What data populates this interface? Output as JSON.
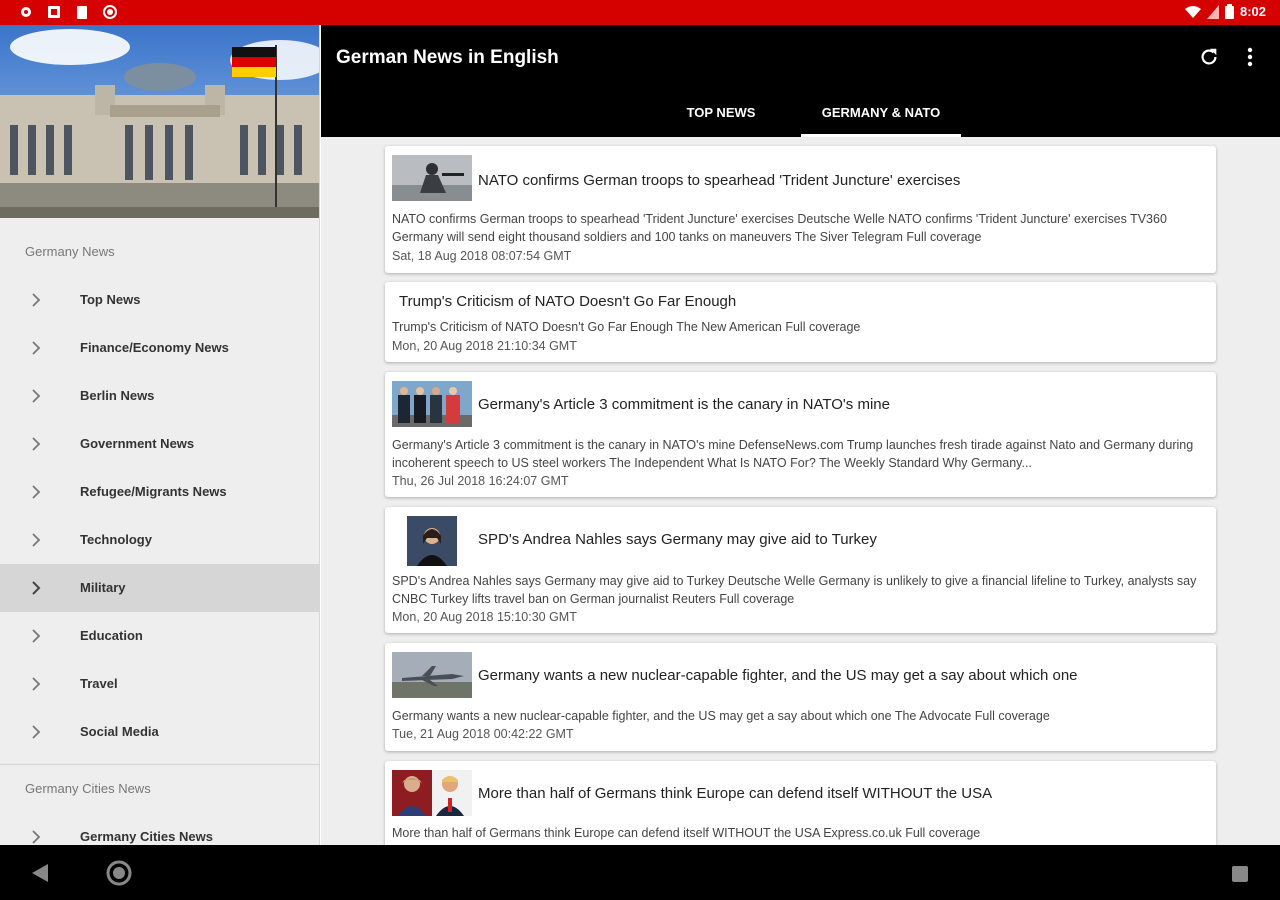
{
  "status_bar": {
    "time": "8:02",
    "left_icons": [
      "settings-icon",
      "screenshot-icon",
      "clipboard-icon",
      "record-icon"
    ],
    "right_icons": [
      "wifi-icon",
      "signal-icon",
      "battery-icon"
    ]
  },
  "app": {
    "title": "German News in English",
    "actions": [
      "refresh-icon",
      "more-vert-icon"
    ],
    "tabs": [
      {
        "label": "TOP NEWS",
        "selected": false
      },
      {
        "label": "GERMANY & NATO",
        "selected": true
      }
    ]
  },
  "drawer": {
    "hero_image": "reichstag-building-image",
    "section1": "Germany News",
    "items": [
      {
        "label": "Top News"
      },
      {
        "label": "Finance/Economy News"
      },
      {
        "label": "Berlin News"
      },
      {
        "label": "Government News"
      },
      {
        "label": "Refugee/Migrants News"
      },
      {
        "label": "Technology"
      },
      {
        "label": "Military",
        "selected": true
      },
      {
        "label": "Education"
      },
      {
        "label": "Travel"
      },
      {
        "label": "Social Media"
      }
    ],
    "section2": "Germany Cities News",
    "items2": [
      {
        "label": "Germany Cities News"
      }
    ]
  },
  "articles": [
    {
      "headline": "NATO confirms German troops to spearhead 'Trident Juncture' exercises",
      "snippet": "NATO confirms German troops to spearhead 'Trident Juncture' exercises  Deutsche Welle  NATO confirms 'Trident Juncture' exercises  TV360  Germany will send eight thousand soldiers and 100 tanks on maneuvers  The Siver Telegram  Full coverage",
      "date": "Sat, 18 Aug 2018 08:07:54 GMT",
      "thumb": "soldier-thumbnail"
    },
    {
      "headline": "Trump's Criticism of NATO Doesn't Go Far Enough",
      "snippet": "Trump's Criticism of NATO Doesn't Go Far Enough  The New American  Full coverage",
      "date": "Mon, 20 Aug 2018 21:10:34 GMT",
      "thumb": ""
    },
    {
      "headline": "Germany's Article 3 commitment is the canary in NATO's mine",
      "snippet": "Germany's Article 3 commitment is the canary in NATO's mine  DefenseNews.com  Trump launches fresh tirade against Nato and Germany during incoherent speech to US steel workers  The Independent  What Is NATO For?  The Weekly Standard  Why Germany...",
      "date": "Thu, 26 Jul 2018 16:24:07 GMT",
      "thumb": "leaders-group-thumbnail"
    },
    {
      "headline": "SPD's Andrea Nahles says Germany may give aid to Turkey",
      "snippet": "SPD's Andrea Nahles says Germany may give aid to Turkey  Deutsche Welle  Germany is unlikely to give a financial lifeline to Turkey, analysts say  CNBC  Turkey lifts travel ban on German journalist  Reuters  Full coverage",
      "date": "Mon, 20 Aug 2018 15:10:30 GMT",
      "thumb": "portrait-thumbnail"
    },
    {
      "headline": "Germany wants a new nuclear-capable fighter, and the US may get a say about which one",
      "snippet": "Germany wants a new nuclear-capable fighter, and the US may get a say about which one  The Advocate  Full coverage",
      "date": "Tue, 21 Aug 2018 00:42:22 GMT",
      "thumb": "fighter-jet-thumbnail"
    },
    {
      "headline": "More than half of Germans think Europe can defend itself WITHOUT the USA",
      "snippet": "More than half of Germans think Europe can defend itself WITHOUT the USA  Express.co.uk  Full coverage",
      "date": "",
      "thumb": "merkel-trump-thumbnail"
    }
  ],
  "nav_bar": {
    "icons": [
      "back-icon",
      "home-icon",
      "recents-icon"
    ]
  },
  "colors": {
    "status_bar": "#d50000",
    "app_bar": "#000000",
    "drawer_bg": "#eeeeee",
    "drawer_selected": "#d6d6d6",
    "content_bg": "#eeeeee"
  }
}
